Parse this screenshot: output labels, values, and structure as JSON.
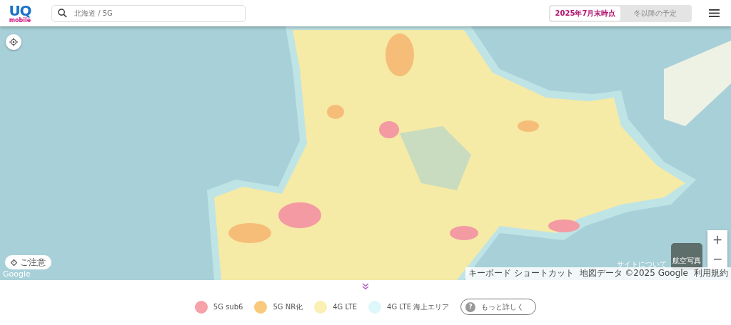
{
  "header": {
    "logo": {
      "line1": "UQ",
      "line2": "mobile"
    },
    "search": {
      "placeholder": "北海道 / 5G"
    },
    "period_tabs": [
      {
        "label": "2025年7月末時点",
        "selected": true
      },
      {
        "label": "冬以降の予定",
        "selected": false
      }
    ]
  },
  "map": {
    "caution": "ご注意",
    "google": "Google",
    "aerial": "航空写真",
    "about": "サイトについて",
    "attribution": [
      "キーボード ショートカット",
      "地図データ ©2025 Google",
      "利用規約"
    ],
    "zoom": [
      "+",
      "−"
    ]
  },
  "legend": [
    {
      "label": "5G sub6",
      "color": "#f7a1a8"
    },
    {
      "label": "5G NR化",
      "color": "#f9c97c"
    },
    {
      "label": "4G LTE",
      "color": "#fbf0b3"
    },
    {
      "label": "4G LTE 海上エリア",
      "color": "#ddf7fb"
    }
  ],
  "more_button": {
    "icon": "?",
    "label": "もっと詳しく"
  }
}
